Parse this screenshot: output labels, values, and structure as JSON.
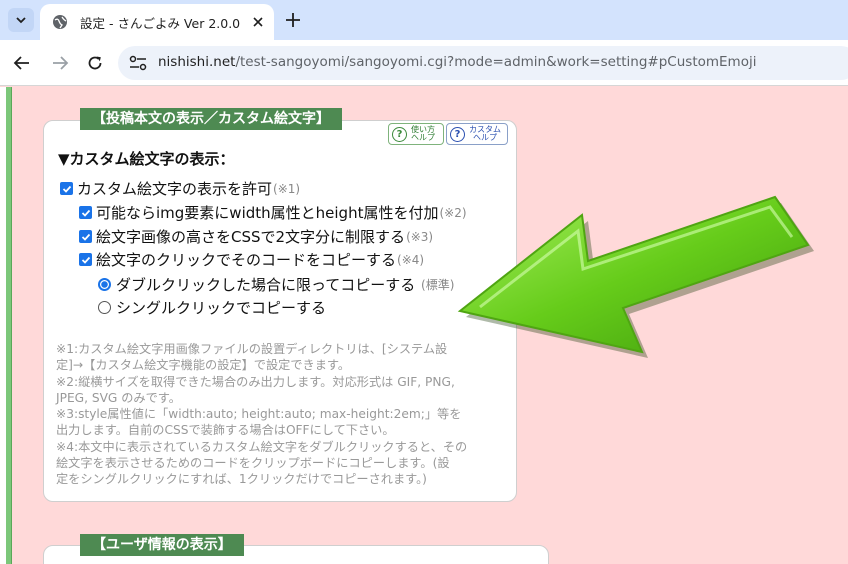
{
  "browser": {
    "tab_title": "設定 - さんごよみ Ver 2.0.0",
    "url_host": "nishishi.net",
    "url_path": "/test-sangoyomi/sangoyomi.cgi?mode=admin&work=setting#pCustomEmoji"
  },
  "panel": {
    "title": "【投稿本文の表示／カスタム絵文字】",
    "help_usage": "使い方\nヘルプ",
    "help_custom": "カスタム\nヘルプ",
    "heading": "▼カスタム絵文字の表示：",
    "options": {
      "allow": {
        "label": "カスタム絵文字の表示を許可",
        "note": "(※1)",
        "checked": true
      },
      "img_attr": {
        "label": "可能ならimg要素にwidth属性とheight属性を付加",
        "note": "(※2)",
        "checked": true
      },
      "css_height": {
        "label": "絵文字画像の高さをCSSで2文字分に制限する",
        "note": "(※3)",
        "checked": true
      },
      "copy_code": {
        "label": "絵文字のクリックでそのコードをコピーする",
        "note": "(※4)",
        "checked": true
      },
      "double_click": {
        "label": "ダブルクリックした場合に限ってコピーする",
        "note": "(標準)",
        "selected": true
      },
      "single_click": {
        "label": "シングルクリックでコピーする",
        "selected": false
      }
    },
    "notes": [
      "※1:カスタム絵文字用画像ファイルの設置ディレクトリは、[システム設",
      "定]→【カスタム絵文字機能の設定】で設定できます。",
      "※2:縦横サイズを取得できた場合のみ出力します。対応形式は GIF, PNG,",
      "JPEG, SVG のみです。",
      "※3:style属性値に「width:auto; height:auto; max-height:2em;」等を",
      "出力します。自前のCSSで装飾する場合はOFFにして下さい。",
      "※4:本文中に表示されているカスタム絵文字をダブルクリックすると、その",
      "絵文字を表示させるためのコードをクリップボードにコピーします。(設",
      "定をシングルクリックにすれば、1クリックだけでコピーされます。)"
    ]
  },
  "panel2": {
    "title": "【ユーザ情報の表示】"
  },
  "colors": {
    "page_bg": "#ffd9d9",
    "section_green": "#4e8a52",
    "checkbox_blue": "#1a73e8",
    "arrow_green": "#66cc1a"
  }
}
